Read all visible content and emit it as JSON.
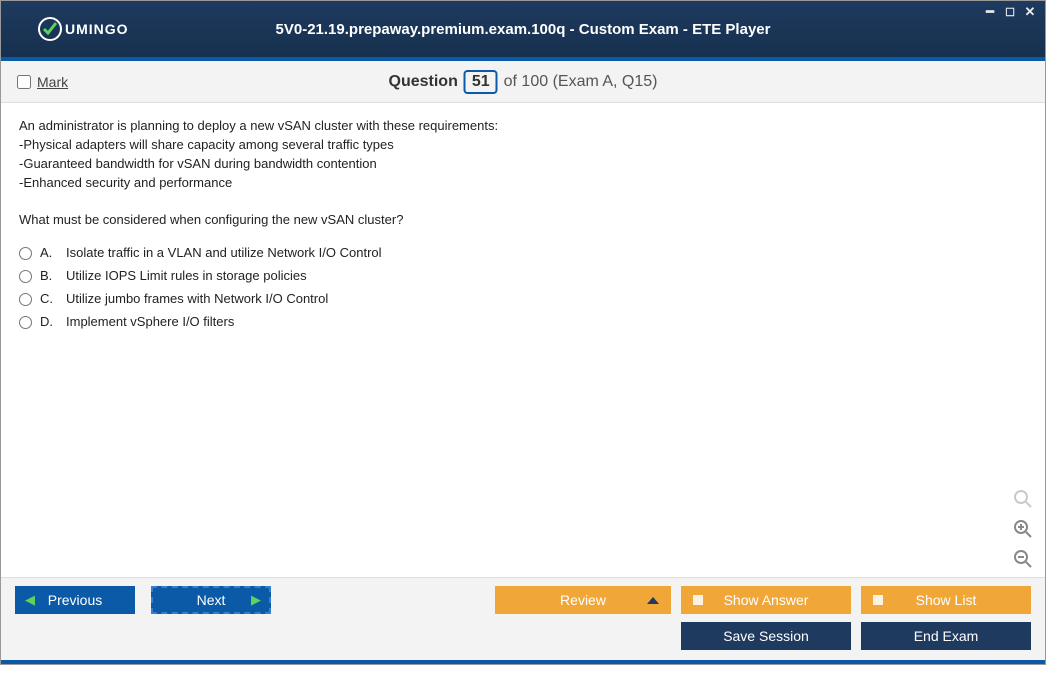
{
  "titlebar": {
    "brand": "UMINGO",
    "title": "5V0-21.19.prepaway.premium.exam.100q - Custom Exam - ETE Player"
  },
  "header": {
    "mark_label": "Mark",
    "question_word": "Question",
    "question_number": "51",
    "of_text": "of 100 (Exam A, Q15)"
  },
  "question": {
    "text": "An administrator is planning to deploy a new vSAN cluster with these requirements:\n-Physical adapters will share capacity among several traffic types\n-Guaranteed bandwidth for vSAN during bandwidth contention\n-Enhanced security and performance\n\nWhat must be considered when configuring the new vSAN cluster?",
    "answers": [
      {
        "letter": "A.",
        "text": "Isolate traffic in a VLAN and utilize Network I/O Control"
      },
      {
        "letter": "B.",
        "text": "Utilize IOPS Limit rules in storage policies"
      },
      {
        "letter": "C.",
        "text": "Utilize jumbo frames with Network I/O Control"
      },
      {
        "letter": "D.",
        "text": "Implement vSphere I/O filters"
      }
    ]
  },
  "footer": {
    "previous": "Previous",
    "next": "Next",
    "review": "Review",
    "show_answer": "Show Answer",
    "show_list": "Show List",
    "save_session": "Save Session",
    "end_exam": "End Exam"
  }
}
